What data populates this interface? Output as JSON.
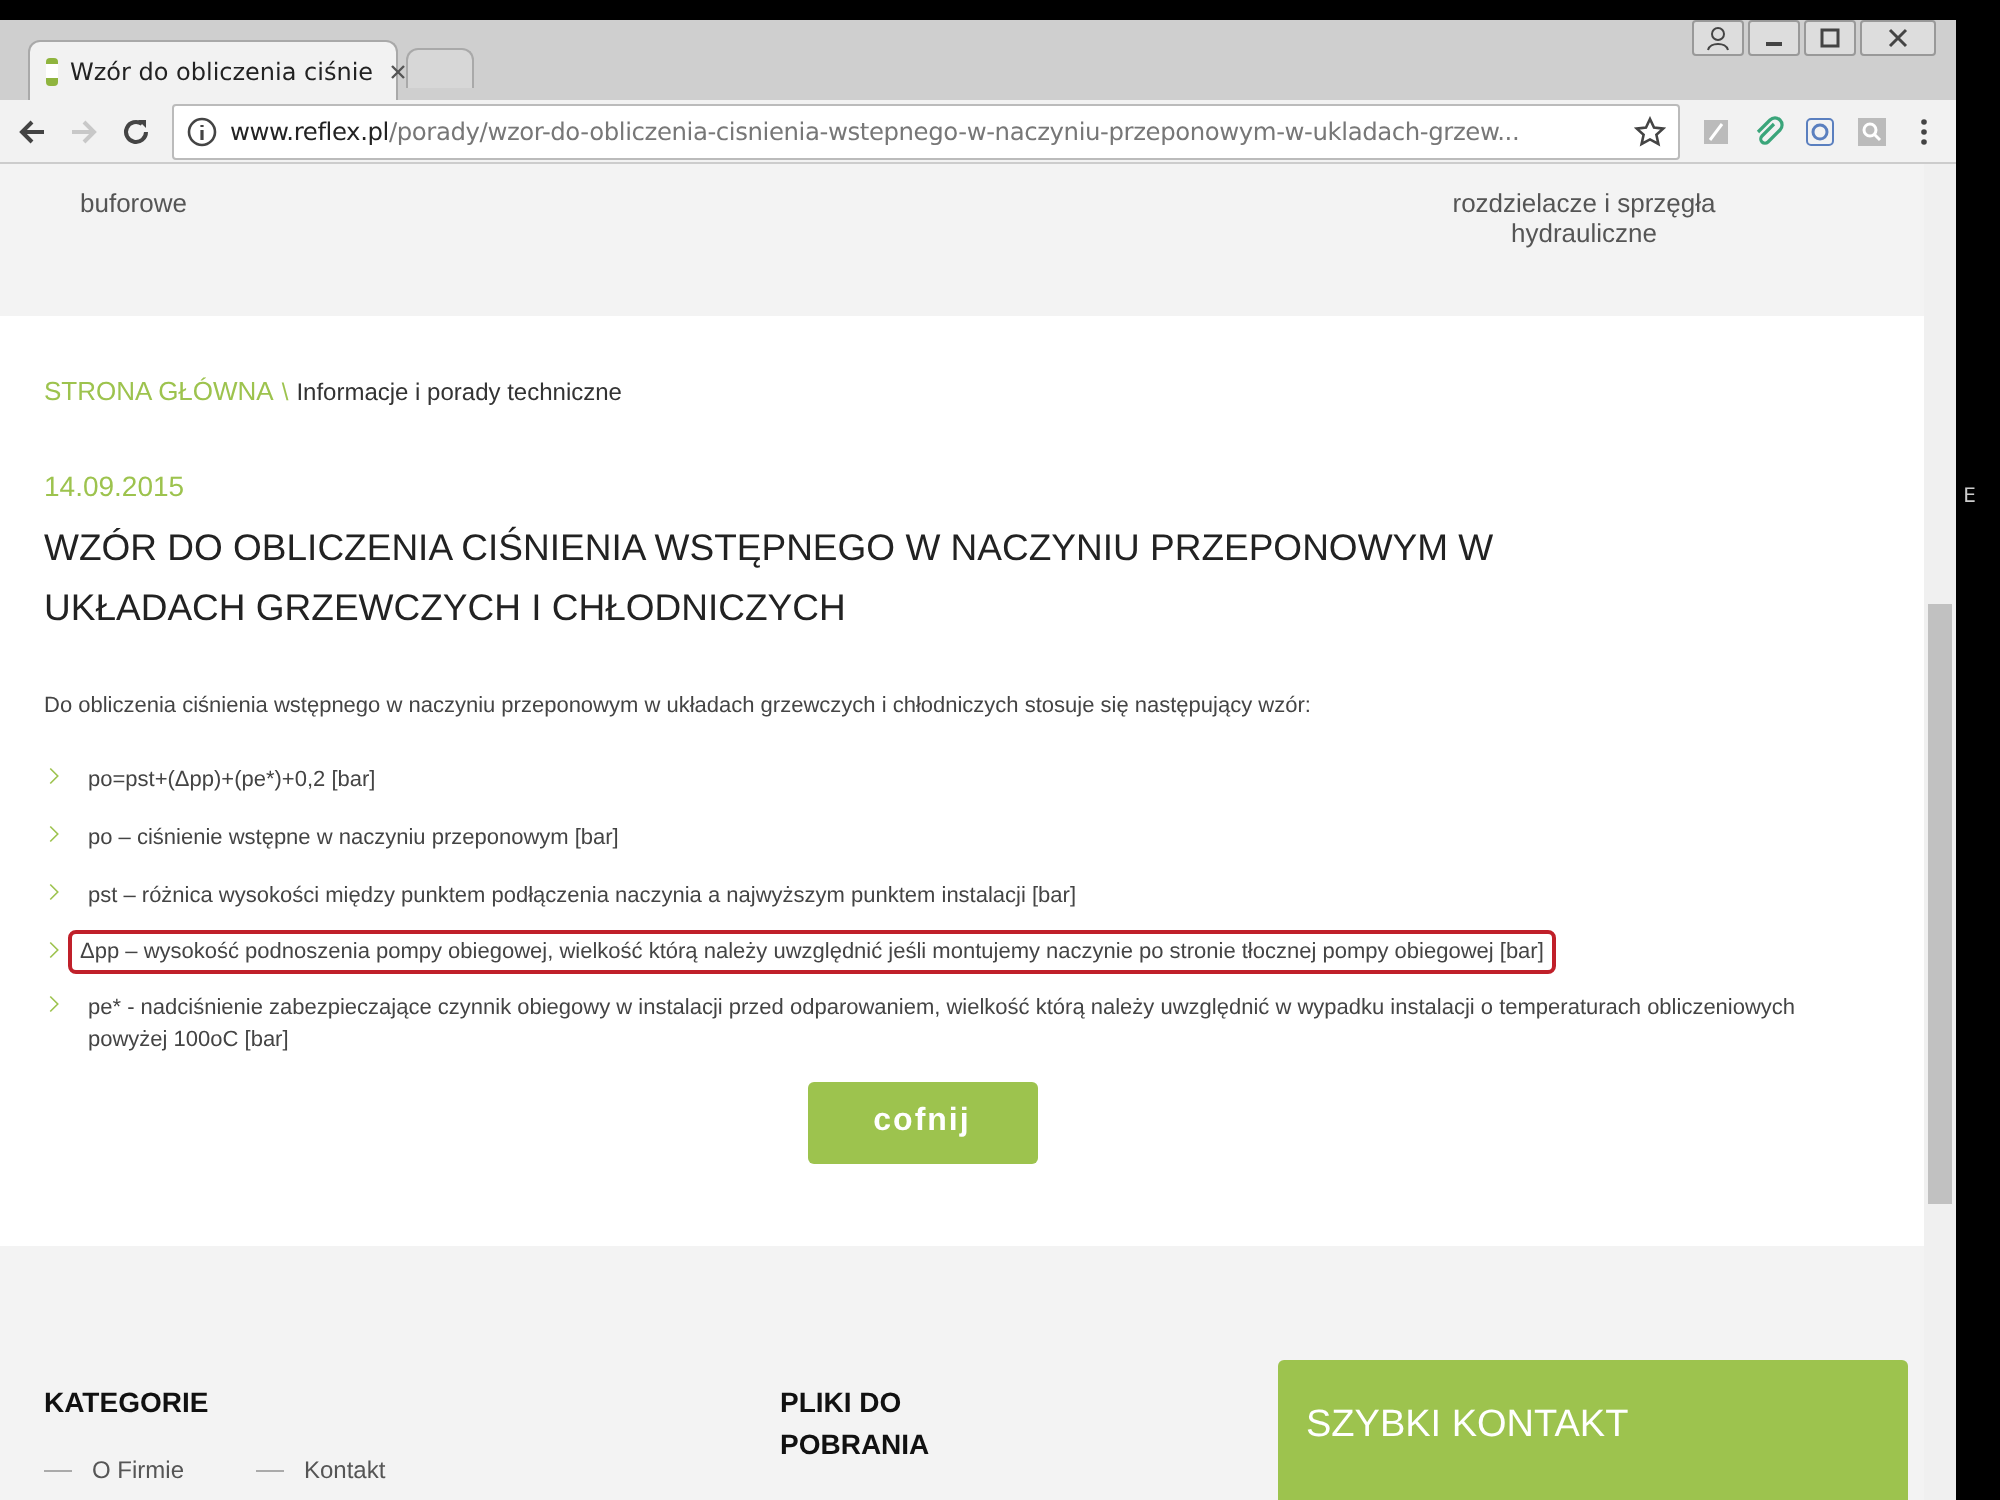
{
  "browser": {
    "tabs": [
      {
        "title": "Wzór do obliczenia ciśnie",
        "selected": true
      },
      {
        "selected": false
      }
    ],
    "url_host": "www.reflex.pl",
    "url_path": "/porady/wzor-do-obliczenia-cisnienia-wstepnego-w-naczyniu-przeponowym-w-ukladach-grzew...",
    "forward_disabled": true
  },
  "top_band": {
    "left": "buforowe",
    "right": "rozdzielacze i sprzęgła hydrauliczne"
  },
  "breadcrumb": {
    "home": "STRONA GŁÓWNA",
    "separator": "\\",
    "current": "Informacje i porady techniczne"
  },
  "article": {
    "date": "14.09.2015",
    "title": "WZÓR DO OBLICZENIA CIŚNIENIA WSTĘPNEGO W NACZYNIU PRZEPONOWYM W UKŁADACH GRZEWCZYCH I CHŁODNICZYCH",
    "intro": "Do obliczenia ciśnienia wstępnego w naczyniu przeponowym w układach grzewczych i chłodniczych stosuje się następujący wzór:",
    "items": [
      {
        "text": "po=pst+(Δpp)+(pe*)+0,2 [bar]",
        "highlighted": false
      },
      {
        "text": "po – ciśnienie wstępne w naczyniu przeponowym [bar]",
        "highlighted": false
      },
      {
        "text": "pst – różnica wysokości między punktem podłączenia naczynia a najwyższym punktem instalacji [bar]",
        "highlighted": false
      },
      {
        "text": "Δpp – wysokość podnoszenia pompy obiegowej, wielkość którą należy uwzględnić jeśli montujemy naczynie po stronie tłocznej pompy obiegowej [bar]",
        "highlighted": true
      },
      {
        "text": "pe* - nadciśnienie zabezpieczające czynnik obiegowy w instalacji przed odparowaniem, wielkość którą należy uwzględnić w wypadku instalacji o temperaturach obliczeniowych powyżej 100oC [bar]",
        "highlighted": false
      }
    ],
    "back_button": "cofnij"
  },
  "footer": {
    "categories_title": "KATEGORIE",
    "links": [
      "O Firmie",
      "Kontakt"
    ],
    "downloads_title": "PLIKI DO POBRANIA",
    "contact_title": "SZYBKI KONTAKT"
  },
  "side_text": "E"
}
